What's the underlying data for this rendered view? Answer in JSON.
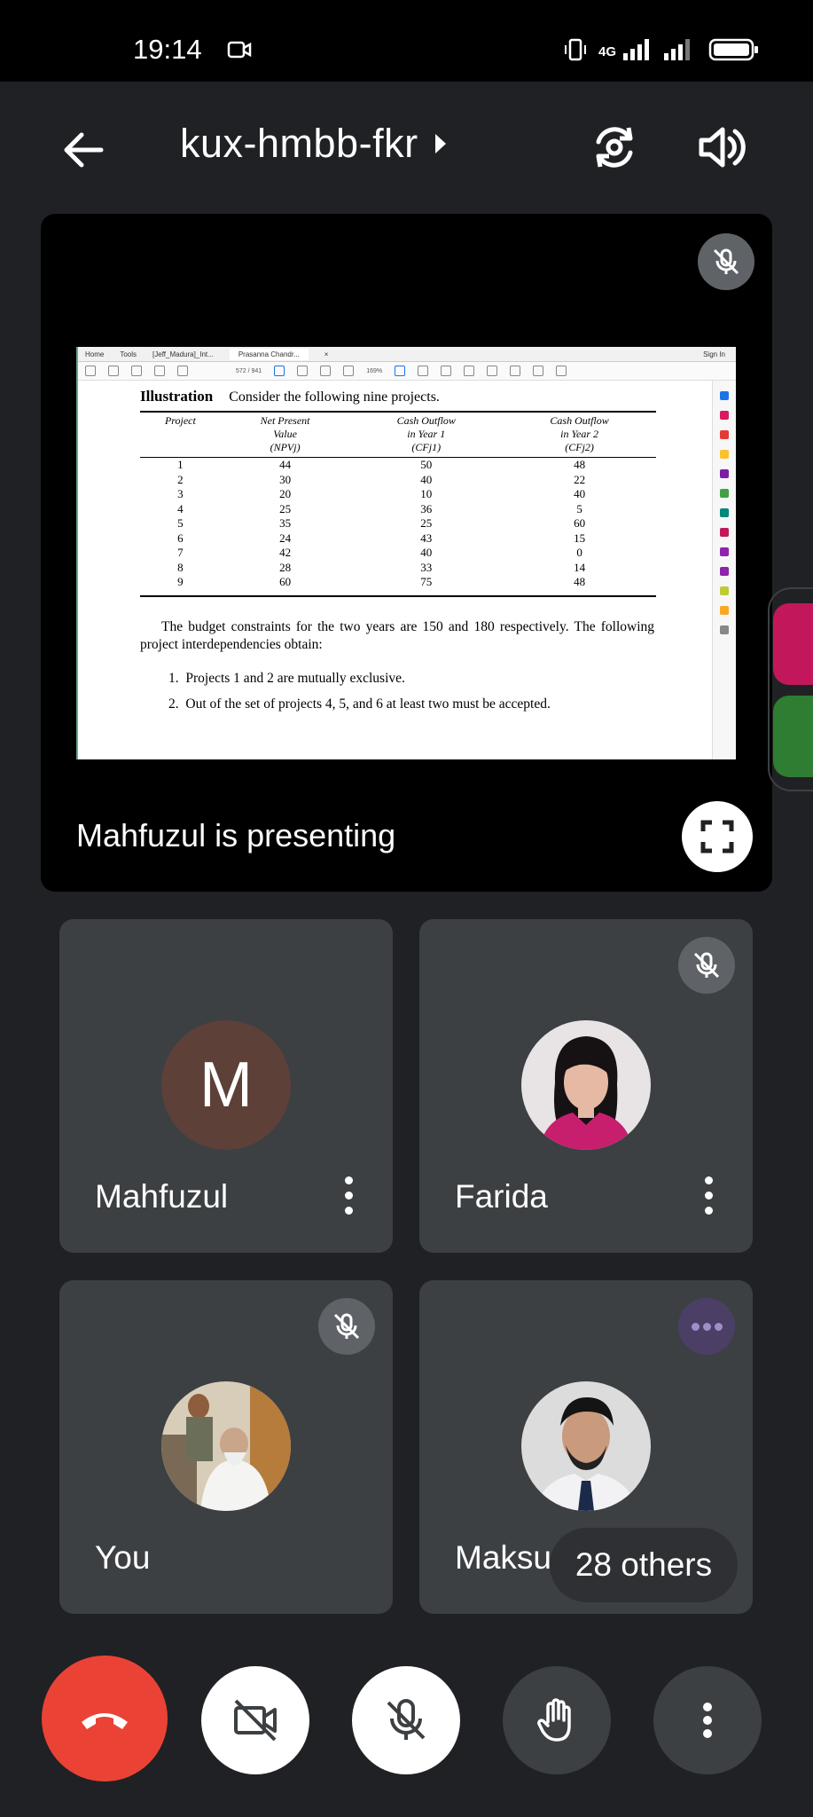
{
  "status_bar": {
    "time": "19:14",
    "network": "4G",
    "icons": [
      "video-recording-icon",
      "vibrate-icon",
      "signal-icon",
      "battery-icon"
    ]
  },
  "header": {
    "meeting_code": "kux-hmbb-fkr",
    "icons": [
      "back-arrow-icon",
      "chevron-right-icon",
      "switch-camera-icon",
      "speaker-icon"
    ]
  },
  "presentation": {
    "label": "Mahfuzul is presenting",
    "muted": true,
    "pdf_viewer": {
      "tabs": [
        "Home",
        "Tools",
        "[Jeff_Madura]_Int...",
        "Prasanna Chandr...",
        "×"
      ],
      "sign_in": "Sign In",
      "page_indicator": "572 / 941",
      "zoom": "169%"
    },
    "document": {
      "heading": "Illustration",
      "intro": "Consider the following nine projects.",
      "columns": [
        {
          "line1": "Project",
          "line2": "",
          "line3": ""
        },
        {
          "line1": "Net Present",
          "line2": "Value",
          "line3": "(NPVj)"
        },
        {
          "line1": "Cash Outflow",
          "line2": "in Year 1",
          "line3": "(CFj1)"
        },
        {
          "line1": "Cash Outflow",
          "line2": "in Year 2",
          "line3": "(CFj2)"
        }
      ],
      "rows": [
        [
          "1",
          "44",
          "50",
          "48"
        ],
        [
          "2",
          "30",
          "40",
          "22"
        ],
        [
          "3",
          "20",
          "10",
          "40"
        ],
        [
          "4",
          "25",
          "36",
          "5"
        ],
        [
          "5",
          "35",
          "25",
          "60"
        ],
        [
          "6",
          "24",
          "43",
          "15"
        ],
        [
          "7",
          "42",
          "40",
          "0"
        ],
        [
          "8",
          "28",
          "33",
          "14"
        ],
        [
          "9",
          "60",
          "75",
          "48"
        ]
      ],
      "budget_text": "The budget constraints for the two years are 150 and 180 respectively. The following project interdependencies obtain:",
      "conditions": [
        {
          "num": "1.",
          "text": "Projects 1 and 2 are mutually exclusive."
        },
        {
          "num": "2.",
          "text": "Out of the set of projects 4, 5, and 6 at least two must be accepted."
        }
      ]
    }
  },
  "participants": [
    {
      "name": "Mahfuzul",
      "avatar_letter": "M",
      "muted": false,
      "avatar_color": "#5d4037"
    },
    {
      "name": "Farida",
      "muted": true
    },
    {
      "name": "You",
      "muted": true
    },
    {
      "name": "Maksud Momin",
      "visible_name": "Maksud",
      "muted": false,
      "speaking_indicator": true
    }
  ],
  "others_count": "28 others",
  "controls": {
    "items": [
      "end-call-icon",
      "camera-off-icon",
      "mic-off-icon",
      "raise-hand-icon",
      "more-options-icon"
    ],
    "colors": {
      "end_call": "#ea4335",
      "active_bg": "#ffffff",
      "inactive_bg": "#3c4043"
    }
  }
}
